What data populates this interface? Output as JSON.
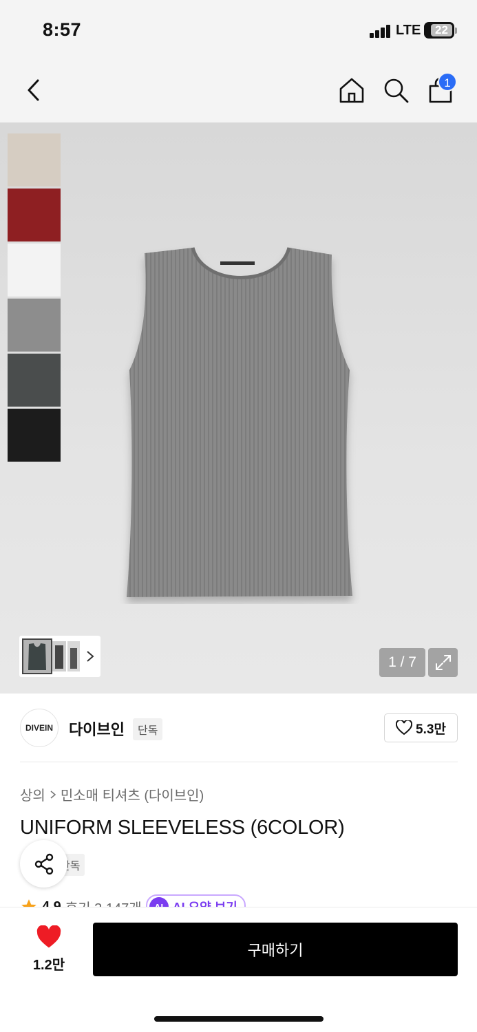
{
  "status": {
    "time": "8:57",
    "network": "LTE",
    "battery": "22"
  },
  "nav": {
    "back_icon": "chevron-left-icon",
    "home_icon": "home-icon",
    "search_icon": "search-icon",
    "cart_icon": "shopping-bag-icon",
    "cart_count": "1"
  },
  "gallery": {
    "swatches": [
      "beige",
      "red",
      "white",
      "gray",
      "charcoal",
      "black"
    ],
    "swatch_colors": [
      "#d6cdc2",
      "#8e1f22",
      "#f3f3f3",
      "#8d8d8d",
      "#4a4d4d",
      "#1c1c1c"
    ],
    "counter": "1 / 7",
    "expand_icon": "expand-icon"
  },
  "brand": {
    "logo_text": "DIVEIN",
    "name": "다이브인",
    "badge": "단독",
    "likes": "5.3만"
  },
  "product": {
    "breadcrumb": [
      "상의",
      "민소매 티셔츠 (다이브인)"
    ],
    "title": "UNIFORM SLEEVELESS (6COLOR)",
    "tag": "단독",
    "rating": "4.9",
    "reviews": "후기 3,147개",
    "ai_label": "AI",
    "ai_summary": "AI 요약 보기"
  },
  "bottom": {
    "wish_count": "1.2만",
    "buy_label": "구매하기"
  },
  "colors": {
    "accent": "#2a6cf6",
    "heart": "#ee1c25",
    "ai_purple": "#7a3cf0",
    "star": "#f7a21b"
  }
}
